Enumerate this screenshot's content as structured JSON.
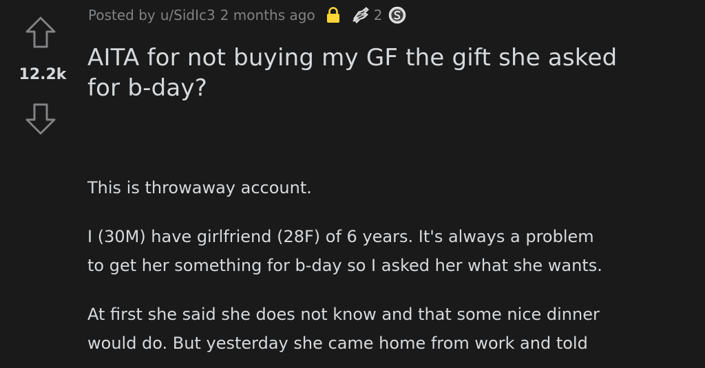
{
  "post": {
    "score": "12.2k",
    "meta": {
      "posted_by": "Posted by",
      "username": "u/SidIc3",
      "time_ago": "2 months ago",
      "award_count": "2"
    },
    "title_lines": [
      "AITA for not buying my GF the gift she asked",
      "for b-day?"
    ],
    "body": {
      "p1": "This is throwaway account.",
      "p2_lines": [
        "I (30M) have girlfriend (28F) of 6 years. It's always a problem",
        "to get her something for b-day so I asked her what she wants."
      ],
      "p3_lines": [
        "At first she said she does not know and that some nice dinner",
        "would do. But yesterday she came home from work and told"
      ]
    }
  },
  "colors": {
    "background": "#1a1a1b",
    "text": "#d7dadc",
    "meta_text": "#818384",
    "lock": "#ffd635",
    "vote_arrow": "#818384"
  },
  "icons": {
    "upvote": "upvote-arrow-icon",
    "downvote": "downvote-arrow-icon",
    "lock": "lock-icon",
    "award": "helping-hand-award-icon",
    "silver": "silver-award-icon"
  }
}
